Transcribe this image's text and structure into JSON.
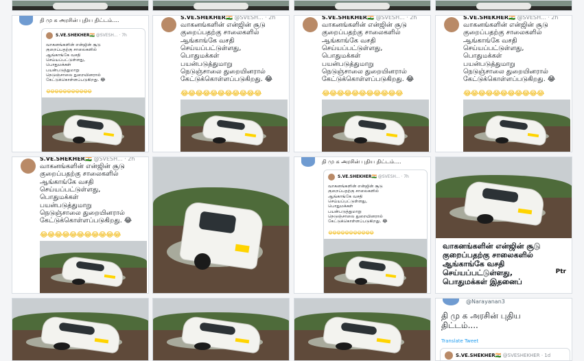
{
  "tweet": {
    "author_name": "S.VE.SHEKHER🇮🇳",
    "author_handle": "@SVESH...",
    "time": "· 7h",
    "time_2h": "· 2h",
    "author_handle_full": "@SVESHEKHER",
    "time_1d": "· 1d",
    "body": "வாகனங்களின் என்ஜின் சூடு\nகுறைப்பதற்கு சாலைகளில்\nஆங்காங்கே வசதி\nசெய்யப்பட்டுள்ளது,\nபொதுமக்கள்\nபயன்படுத்துமாறு\nநெடுஞ்சாலை துறையினரால்\nகேட்டுக்கொள்ளப்படுகிறது. 😂",
    "emojis": "😂😂😂😂😂😂😂😂😂😂😂"
  },
  "quote_caption": "தி மு க அரசின் புதிய திட்டம்....",
  "large_caption": "தி மு க அரசின் புதிய\nதிட்டம்....",
  "translate_label": "Translate Tweet",
  "narayanan_handle": "@Narayanan3",
  "overlay_caption": "வாகனங்களின் என்ஜின் சூடு\nகுறைப்பதற்கு சாலைகளில்\nஆங்காங்கே வசதி\nசெய்யப்பட்டுள்ளது,\nபொதுமக்கள் இதனைப்",
  "ptr_label": "Ptr",
  "grid": {
    "row1": [
      "strip",
      "strip",
      "strip",
      "strip"
    ],
    "row2": [
      "quote-tweet",
      "tweet-photo",
      "tweet-photo",
      "tweet-photo"
    ],
    "row3": [
      "tweet-photo",
      "photo",
      "quote-tweet",
      "photo-caption"
    ],
    "row4": [
      "photo",
      "photo",
      "photo",
      "tweet-large"
    ]
  }
}
